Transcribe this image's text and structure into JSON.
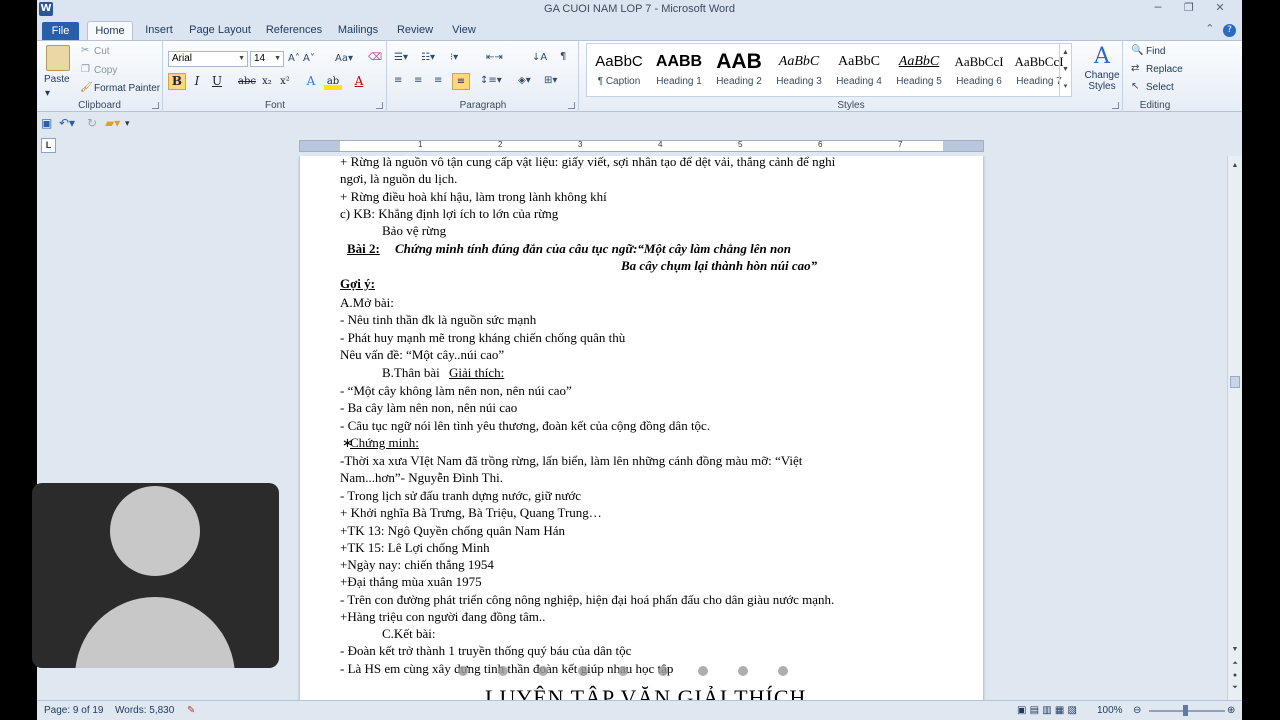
{
  "window": {
    "title": "GA CUOI NAM LOP 7 - Microsoft Word",
    "logo_letter": "W",
    "buttons": [
      "─",
      "❐",
      "✕"
    ]
  },
  "tabs": [
    "File",
    "Home",
    "Insert",
    "Page Layout",
    "References",
    "Mailings",
    "Review",
    "View"
  ],
  "ribbon": {
    "clipboard": {
      "paste": "Paste",
      "cut": "Cut",
      "copy": "Copy",
      "format_painter": "Format Painter",
      "label": "Clipboard"
    },
    "font": {
      "name": "Arial",
      "size": "14",
      "label": "Font"
    },
    "paragraph": {
      "label": "Paragraph"
    },
    "styles": {
      "label": "Styles",
      "items": [
        {
          "preview": "AaBbC",
          "name": "¶ Caption"
        },
        {
          "preview": "AABB",
          "name": "Heading 1"
        },
        {
          "preview": "AAB",
          "name": "Heading 2"
        },
        {
          "preview": "AaBbC",
          "name": "Heading 3"
        },
        {
          "preview": "AaBbC",
          "name": "Heading 4"
        },
        {
          "preview": "AaBbC",
          "name": "Heading 5"
        },
        {
          "preview": "AaBbCcI",
          "name": "Heading 6"
        },
        {
          "preview": "AaBbCcI",
          "name": "Heading 7"
        }
      ],
      "change_styles": "Change Styles"
    },
    "editing": {
      "find": "Find",
      "replace": "Replace",
      "select": "Select",
      "label": "Editing"
    }
  },
  "ruler_numbers": [
    "1",
    "2",
    "3",
    "4",
    "5",
    "6",
    "7"
  ],
  "document": {
    "lines": [
      "+ Rừng là nguồn vô tận cung cấp vật liệu: giấy viết, sợi nhân tạo để dệt vải, thắng cảnh để nghỉ",
      "ngơi, là nguồn du lịch.",
      "+ Rừng điều hoà khí hậu, làm trong lành không khí",
      "c) KB: Khẳng định lợi ích to lớn của rừng",
      "Bảo vệ rừng",
      "Bài 2:",
      "Chứng minh tính đúng đắn của câu tục ngữ:“Một cây làm chẳng lên non",
      "Ba cây chụm lại thành hòn núi cao”",
      "Gợi ý:",
      "A.Mở bài:",
      "- Nêu tinh thần đk là nguồn sức mạnh",
      "- Phát huy mạnh mẽ trong kháng chiến chống quân thù",
      "Nêu vấn đề: “Một cây..núi cao”",
      "B.Thân bài",
      "Giải thích:",
      "- “Một cây không làm nên non, nên núi cao”",
      "- Ba cây làm nên non, nên núi cao",
      "- Câu tục ngữ nói lên tình yêu thương, đoàn kết của cộng đồng dân tộc.",
      "∗",
      "Chứng minh:",
      "-Thời xa xưa VIệt Nam đã trồng rừng, lấn biển, làm lên những cánh đồng màu mỡ: “Việt",
      "Nam...hơn”- Nguyễn Đình Thi.",
      "- Trong lịch sử đấu tranh dựng nước, giữ nước",
      "+ Khởi nghĩa Bà Trưng, Bà Triệu, Quang Trung…",
      "+TK 13: Ngô Quyền chống quân Nam Hán",
      "+TK 15: Lê Lợi chống Minh",
      "+Ngày nay: chiến thắng 1954",
      "+Đại thắng mùa xuân 1975",
      "- Trên con đường phát triển công nông nghiệp, hiện đại hoá phấn đấu cho dân giàu nước mạnh.",
      "+Hàng triệu con người đang đồng tâm..",
      "C.Kết bài:",
      "- Đoàn kết trở thành 1 truyền thống quý báu của dân tộc",
      "- Là HS em cùng xây dựng tinh thần đoàn kết giúp nhau học tập",
      "LUYỆN TẬP VĂN GIẢI THÍCH"
    ]
  },
  "status": {
    "page": "Page: 9 of 19",
    "words": "Words: 5,830",
    "zoom": "100%"
  }
}
